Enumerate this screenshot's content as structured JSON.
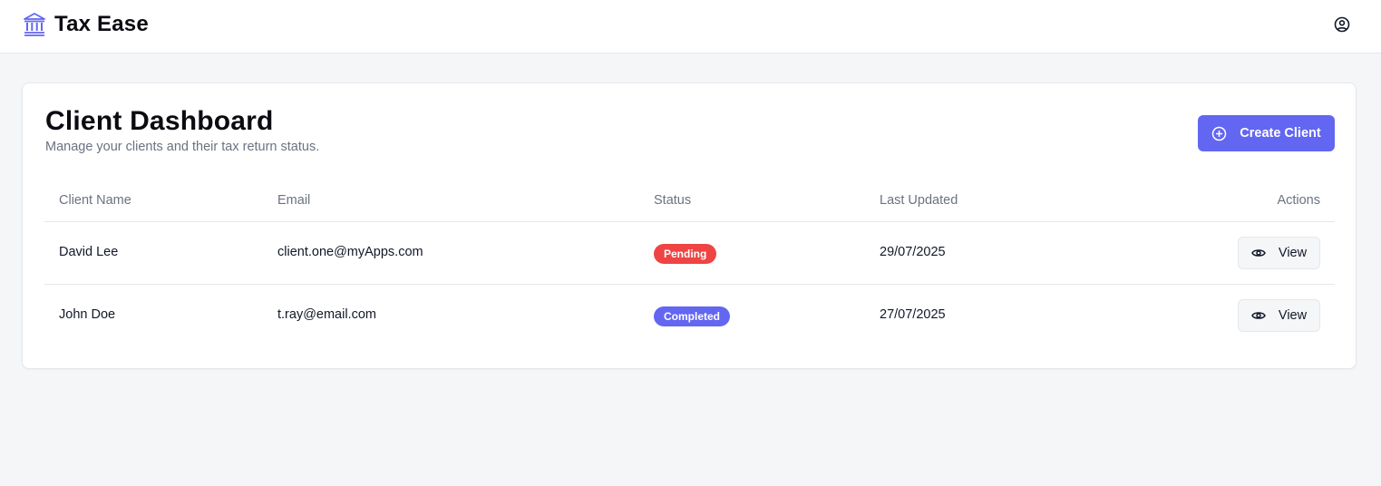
{
  "app": {
    "brand": "Tax Ease",
    "brand_icon": "bank-building-icon",
    "account_icon": "user-circle-icon",
    "accent_color": "#6366f1"
  },
  "dashboard": {
    "title": "Client Dashboard",
    "subtitle": "Manage your clients and their tax return status.",
    "create_button_label": "Create Client",
    "create_button_icon": "plus-circle-icon"
  },
  "table": {
    "columns": {
      "name": "Client Name",
      "email": "Email",
      "status": "Status",
      "updated": "Last Updated",
      "actions": "Actions"
    },
    "rows": [
      {
        "name": "David Lee",
        "email": "client.one@myApps.com",
        "status": "Pending",
        "status_color": "#ef4444",
        "updated": "29/07/2025",
        "action_label": "View"
      },
      {
        "name": "John Doe",
        "email": "t.ray@email.com",
        "status": "Completed",
        "status_color": "#6366f1",
        "updated": "27/07/2025",
        "action_label": "View"
      }
    ]
  }
}
